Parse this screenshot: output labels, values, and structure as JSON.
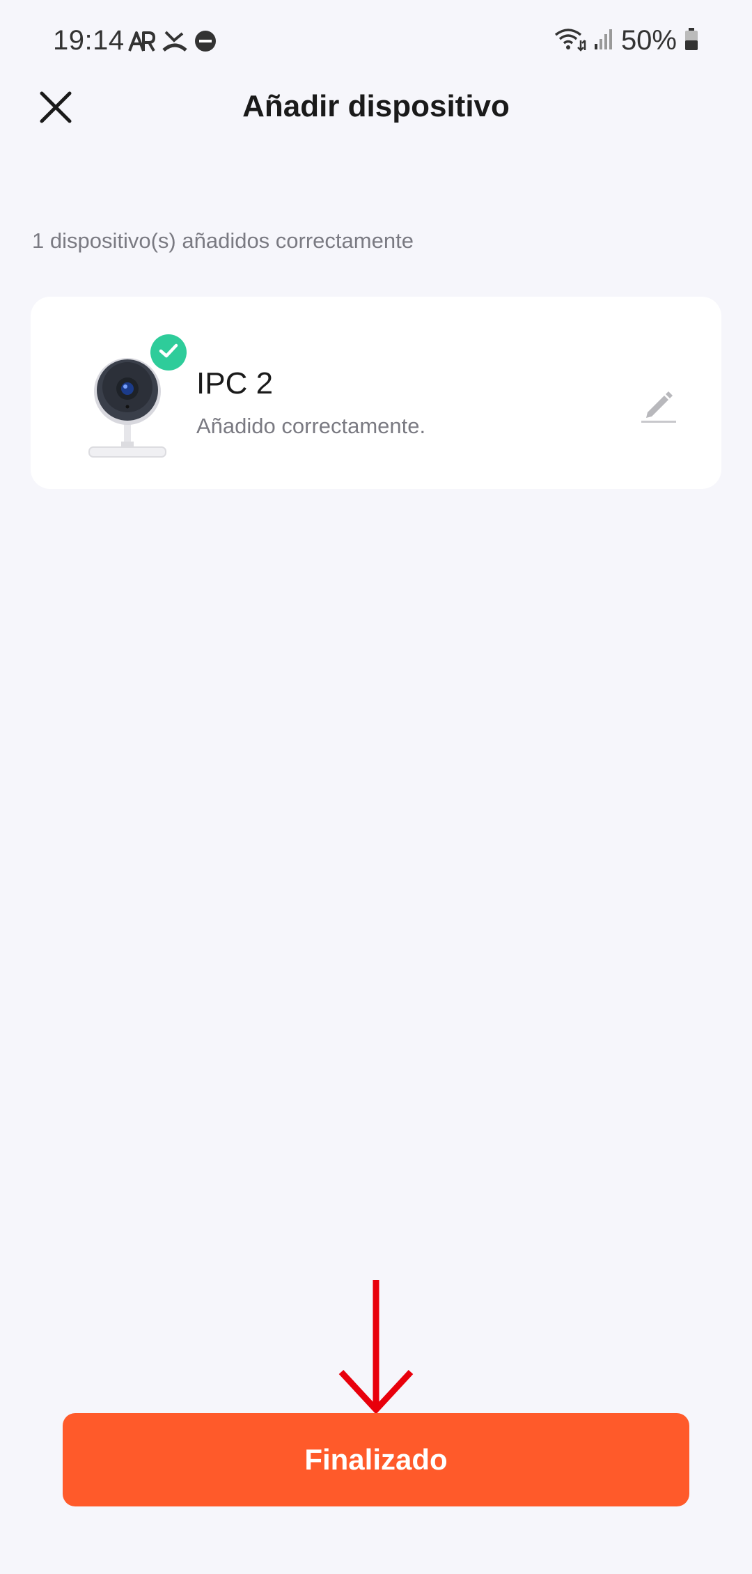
{
  "status_bar": {
    "time": "19:14",
    "battery_percent": "50%",
    "left_icons": [
      "ar-icon",
      "missed-call-icon",
      "do-not-disturb-icon"
    ],
    "right_icons": [
      "wifi-icon",
      "signal-icon",
      "battery-icon"
    ]
  },
  "header": {
    "title": "Añadir dispositivo",
    "close_icon": "close-icon"
  },
  "summary": {
    "text": "1 dispositivo(s) añadidos correctamente"
  },
  "devices": [
    {
      "name": "IPC 2",
      "status": "Añadido correctamente.",
      "image_icon": "camera-icon",
      "badge_icon": "check-icon",
      "edit_icon": "pencil-icon"
    }
  ],
  "footer": {
    "button_label": "Finalizado"
  },
  "colors": {
    "background": "#f6f6fb",
    "accent": "#ff5a2a",
    "success": "#2ecc9a",
    "annotation_arrow": "#e8000b"
  }
}
